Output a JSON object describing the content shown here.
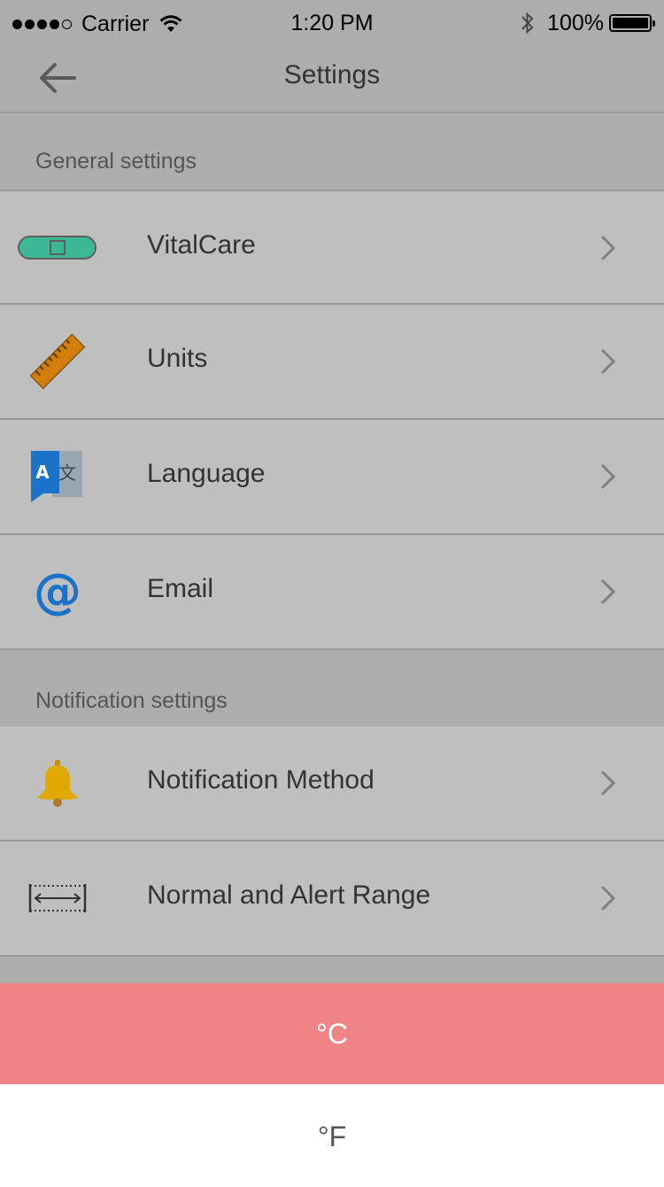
{
  "status_bar": {
    "carrier": "Carrier",
    "time": "1:20 PM",
    "battery": "100%"
  },
  "nav": {
    "title": "Settings",
    "back_icon": "arrow-left-icon"
  },
  "sections": [
    {
      "header": "General settings",
      "items": [
        {
          "label": "VitalCare",
          "icon": "device-icon"
        },
        {
          "label": "Units",
          "icon": "ruler-icon"
        },
        {
          "label": "Language",
          "icon": "translate-icon"
        },
        {
          "label": "Email",
          "icon": "at-icon"
        }
      ]
    },
    {
      "header": "Notification settings",
      "items": [
        {
          "label": "Notification Method",
          "icon": "bell-icon"
        },
        {
          "label": "Normal and Alert Range",
          "icon": "range-icon"
        }
      ]
    }
  ],
  "picker": {
    "options": [
      "°C",
      "°F"
    ],
    "selected": "°C"
  },
  "colors": {
    "overlay_gray": "#adadad",
    "row_gray": "#bfbfbf",
    "selected_red": "#ef8385",
    "device_green": "#3db896",
    "ruler_orange": "#d17f09",
    "translate_blue": "#1a73c8",
    "bell_yellow": "#e0a800"
  }
}
